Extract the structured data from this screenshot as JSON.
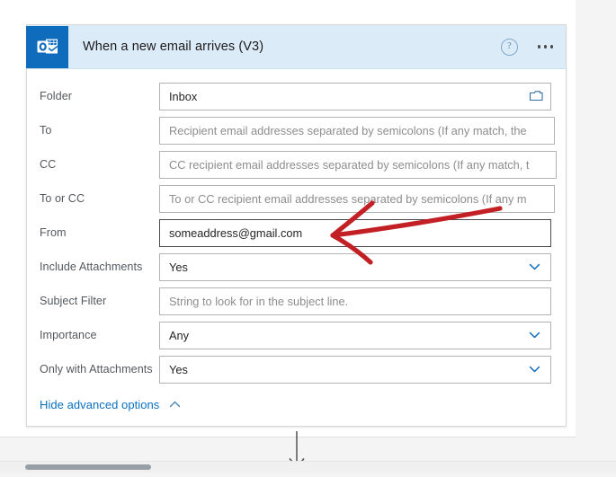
{
  "card": {
    "title": "When a new email arrives (V3)",
    "app_icon": "outlook-icon",
    "help_icon": "?",
    "menu_icon": "ellipsis-icon",
    "header_bg": "#dcebf8",
    "icon_bg": "#0f6cbd",
    "accent": "#0a70c0"
  },
  "fields": [
    {
      "label": "Folder",
      "type": "text-with-picker",
      "value": "Inbox",
      "placeholder": "",
      "is_placeholder": false,
      "trailing_icon": "folder-icon"
    },
    {
      "label": "To",
      "type": "text",
      "value": "Recipient email addresses separated by semicolons (If any match, the",
      "placeholder": "Recipient email addresses separated by semicolons (If any match, the",
      "is_placeholder": true,
      "trailing_icon": ""
    },
    {
      "label": "CC",
      "type": "text",
      "value": "CC recipient email addresses separated by semicolons (If any match, t",
      "placeholder": "CC recipient email addresses separated by semicolons (If any match, t",
      "is_placeholder": true,
      "trailing_icon": ""
    },
    {
      "label": "To or CC",
      "type": "text",
      "value": "To or CC recipient email addresses separated by semicolons (If any m",
      "placeholder": "To or CC recipient email addresses separated by semicolons (If any m",
      "is_placeholder": true,
      "trailing_icon": ""
    },
    {
      "label": "From",
      "type": "text",
      "value": "someaddress@gmail.com",
      "placeholder": "",
      "is_placeholder": false,
      "focused": true,
      "trailing_icon": ""
    },
    {
      "label": "Include Attachments",
      "type": "select",
      "value": "Yes",
      "placeholder": "",
      "is_placeholder": false,
      "trailing_icon": "chevron-down-icon"
    },
    {
      "label": "Subject Filter",
      "type": "text",
      "value": "String to look for in the subject line.",
      "placeholder": "String to look for in the subject line.",
      "is_placeholder": true,
      "trailing_icon": ""
    },
    {
      "label": "Importance",
      "type": "select",
      "value": "Any",
      "placeholder": "",
      "is_placeholder": false,
      "trailing_icon": "chevron-down-icon"
    },
    {
      "label": "Only with Attachments",
      "type": "select",
      "value": "Yes",
      "placeholder": "",
      "is_placeholder": false,
      "trailing_icon": "chevron-down-icon"
    }
  ],
  "advanced": {
    "label": "Hide advanced options",
    "caret_icon": "chevron-up-icon"
  },
  "connector": {
    "icon": "arrow-down-icon"
  },
  "annotation": {
    "color": "#c32026",
    "shape": "left-pointing-arrow"
  },
  "scrollbar": {
    "orientation": "horizontal"
  }
}
